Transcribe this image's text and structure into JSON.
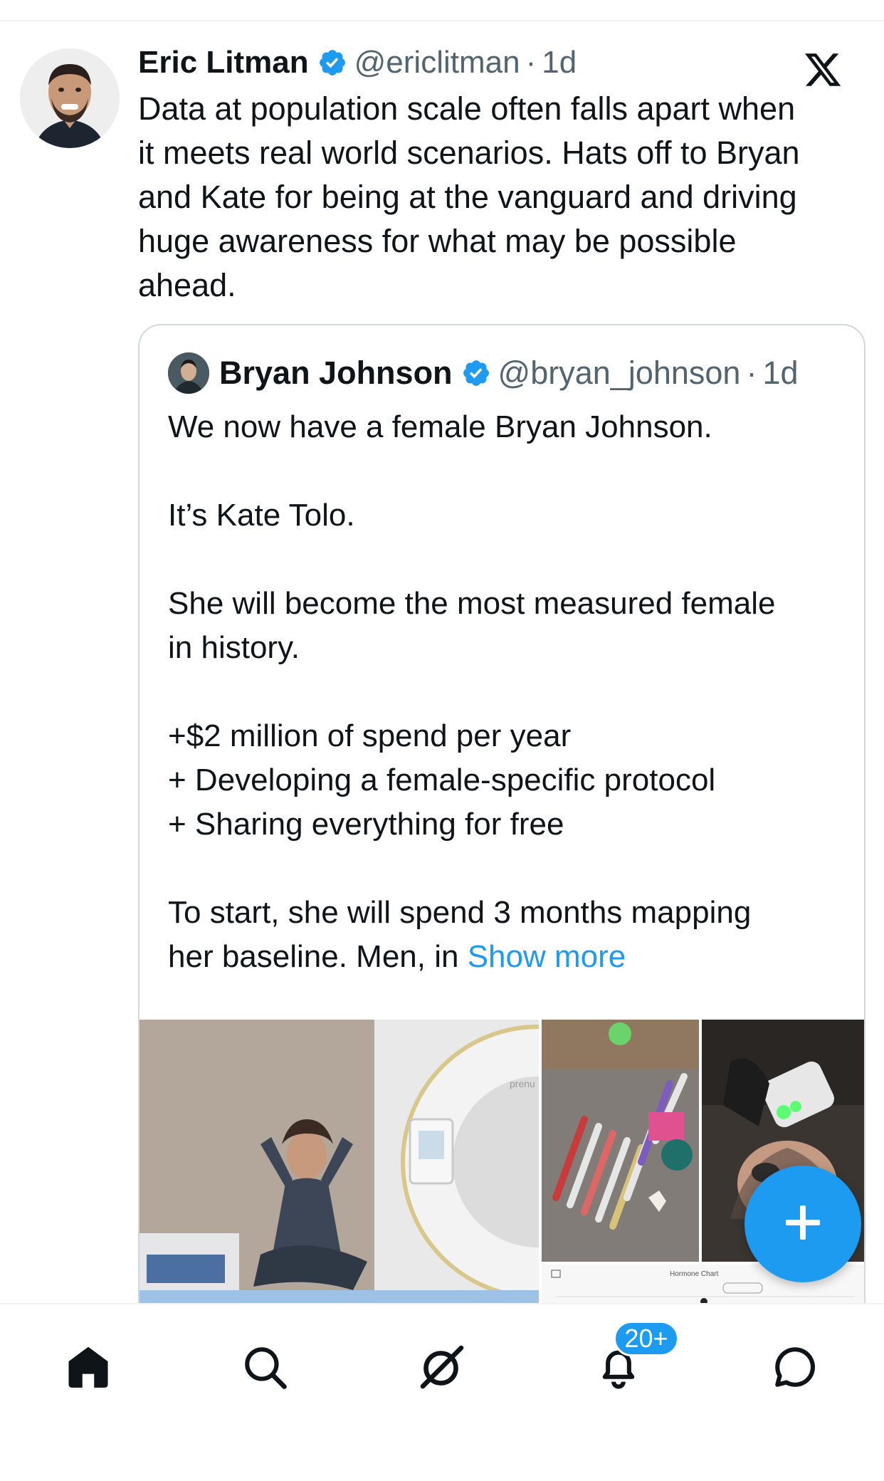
{
  "tweet": {
    "author_name": "Eric Litman",
    "handle": "@ericlitman",
    "separator": "·",
    "time": "1d",
    "text": "Data at population scale often falls apart when\nit meets real world scenarios. Hats off to Bryan\nand Kate for being at the vanguard and driving\nhuge awareness for what may be possible\nahead."
  },
  "quote": {
    "author_name": "Bryan Johnson",
    "handle": "@bryan_johnson",
    "separator": "·",
    "time": "1d",
    "text": "We now have a female Bryan Johnson.\n\nIt’s Kate Tolo.\n\nShe will become the most measured female\nin history.\n\n+$2 million of spend per year\n+ Developing a female-specific protocol\n+ Sharing everything for free\n\nTo start, she will spend 3 months mapping\nher baseline. Men, in ",
    "show_more": "Show more",
    "media_label": "Hormone Chart",
    "equipment_text": "prenu"
  },
  "tabbar": {
    "notifications_badge": "20+"
  },
  "icons": {
    "verified": "verified-badge-icon",
    "brand": "x-logo-icon",
    "fab": "plus-icon",
    "tabs": [
      "home-icon",
      "search-icon",
      "grok-icon",
      "notifications-icon",
      "messages-icon"
    ]
  },
  "colors": {
    "accent": "#1d9bf0",
    "text": "#0f1419",
    "secondary": "#536471",
    "border": "#cfd9de"
  }
}
